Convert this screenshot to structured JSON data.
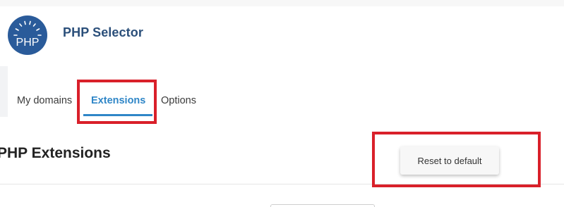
{
  "header": {
    "logo_text": "PHP",
    "logo_icon": "php-gauge-logo",
    "title": "PHP Selector"
  },
  "tabs": [
    {
      "label": "My domains",
      "active": false
    },
    {
      "label": "Extensions",
      "active": true
    },
    {
      "label": "Options",
      "active": false
    }
  ],
  "section": {
    "title": "PHP Extensions",
    "reset_label": "Reset to default"
  },
  "colors": {
    "brand": "#2b4f7a",
    "logo_bg": "#2a5b9a",
    "active_tab": "#2f86c7",
    "highlight": "#d9202a"
  }
}
